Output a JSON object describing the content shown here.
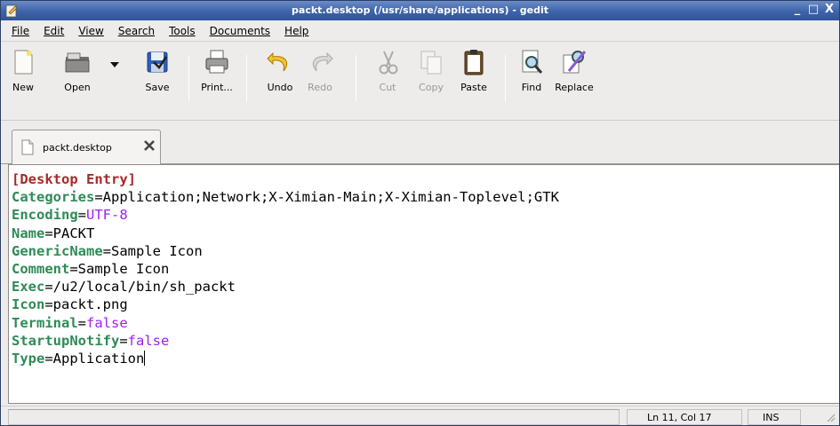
{
  "window": {
    "title": "packt.desktop (/usr/share/applications) - gedit",
    "controls": {
      "minimize": "_",
      "maximize": "□",
      "close": "X"
    }
  },
  "menu": [
    {
      "label": "File"
    },
    {
      "label": "Edit"
    },
    {
      "label": "View"
    },
    {
      "label": "Search"
    },
    {
      "label": "Tools"
    },
    {
      "label": "Documents"
    },
    {
      "label": "Help"
    }
  ],
  "toolbar": {
    "new": "New",
    "open": "Open",
    "save": "Save",
    "print": "Print...",
    "undo": "Undo",
    "redo": "Redo",
    "cut": "Cut",
    "copy": "Copy",
    "paste": "Paste",
    "find": "Find",
    "replace": "Replace"
  },
  "tab": {
    "label": "packt.desktop"
  },
  "editor": {
    "lines": [
      {
        "key": "[Desktop Entry]",
        "eq": "",
        "value": ""
      },
      {
        "key": "Categories",
        "eq": "=",
        "value": "Application;Network;X-Ximian-Main;X-Ximian-Toplevel;GTK"
      },
      {
        "key": "Encoding",
        "eq": "=",
        "value": "UTF-8"
      },
      {
        "key": "Name",
        "eq": "=",
        "value": "PACKT"
      },
      {
        "key": "GenericName",
        "eq": "=",
        "value": "Sample Icon"
      },
      {
        "key": "Comment",
        "eq": "=",
        "value": "Sample Icon"
      },
      {
        "key": "Exec",
        "eq": "=",
        "value": "/u2/local/bin/sh_packt"
      },
      {
        "key": "Icon",
        "eq": "=",
        "value": "packt.png"
      },
      {
        "key": "Terminal",
        "eq": "=",
        "value": "false"
      },
      {
        "key": "StartupNotify",
        "eq": "=",
        "value": "false"
      },
      {
        "key": "Type",
        "eq": "=",
        "value": "Application"
      }
    ]
  },
  "status": {
    "position": "Ln 11, Col 17",
    "mode": "INS"
  },
  "colors": {
    "titlebar": "#3d63a8",
    "section_header": "#a52a2a",
    "key": "#2e8b57",
    "keyword_value": "#a020f0"
  }
}
